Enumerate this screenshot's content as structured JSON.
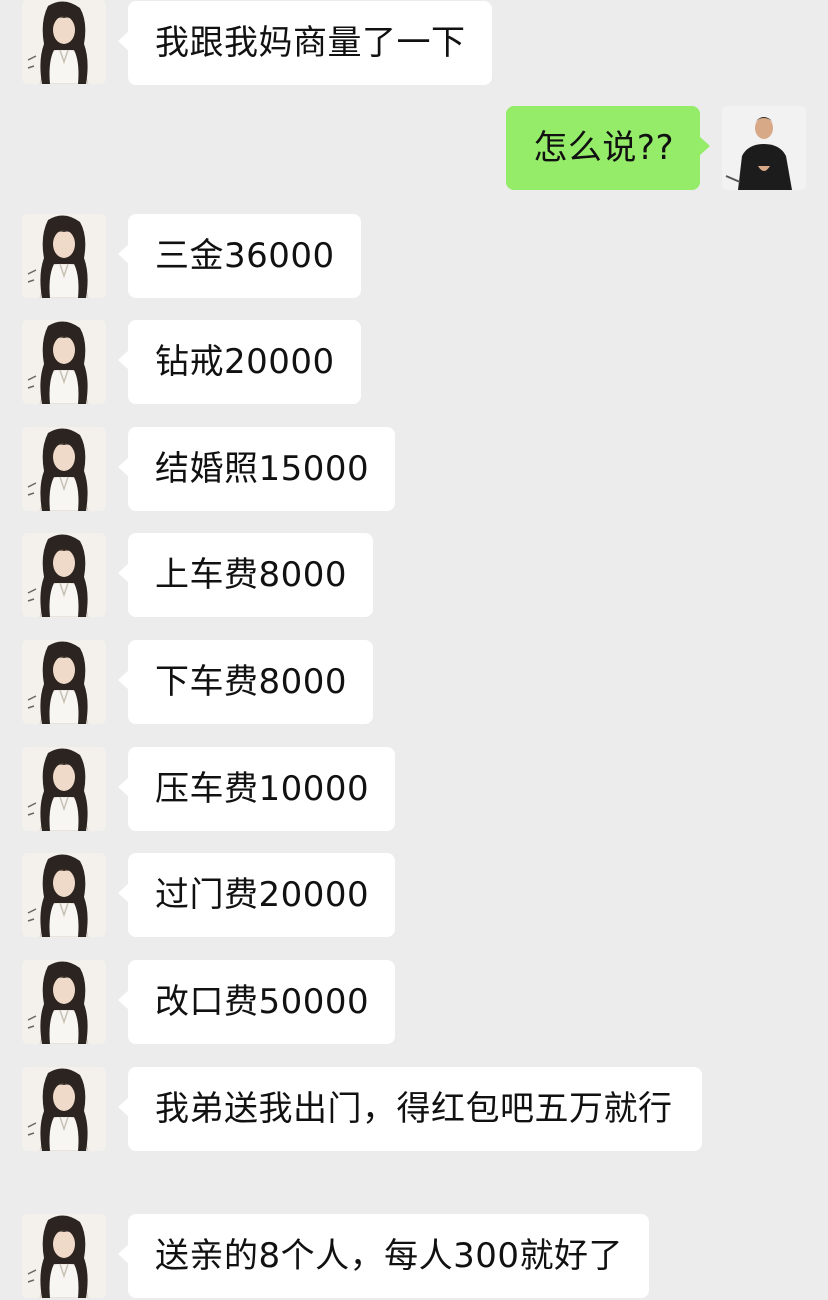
{
  "colors": {
    "background": "#ececec",
    "incoming_bubble": "#ffffff",
    "outgoing_bubble": "#95ec69",
    "text": "#111111"
  },
  "messages": [
    {
      "sender": "other",
      "avatar": "female-avatar",
      "text": "我跟我妈商量了一下"
    },
    {
      "sender": "self",
      "avatar": "male-avatar",
      "text": "怎么说??"
    },
    {
      "sender": "other",
      "avatar": "female-avatar",
      "text": "三金36000"
    },
    {
      "sender": "other",
      "avatar": "female-avatar",
      "text": "钻戒20000"
    },
    {
      "sender": "other",
      "avatar": "female-avatar",
      "text": "结婚照15000"
    },
    {
      "sender": "other",
      "avatar": "female-avatar",
      "text": "上车费8000"
    },
    {
      "sender": "other",
      "avatar": "female-avatar",
      "text": "下车费8000"
    },
    {
      "sender": "other",
      "avatar": "female-avatar",
      "text": "压车费10000"
    },
    {
      "sender": "other",
      "avatar": "female-avatar",
      "text": "过门费20000"
    },
    {
      "sender": "other",
      "avatar": "female-avatar",
      "text": "改口费50000"
    },
    {
      "sender": "other",
      "avatar": "female-avatar",
      "text": "我弟送我出门，得红包吧五万就行"
    },
    {
      "sender": "other",
      "avatar": "female-avatar",
      "text": "送亲的8个人，每人300就好了"
    }
  ]
}
